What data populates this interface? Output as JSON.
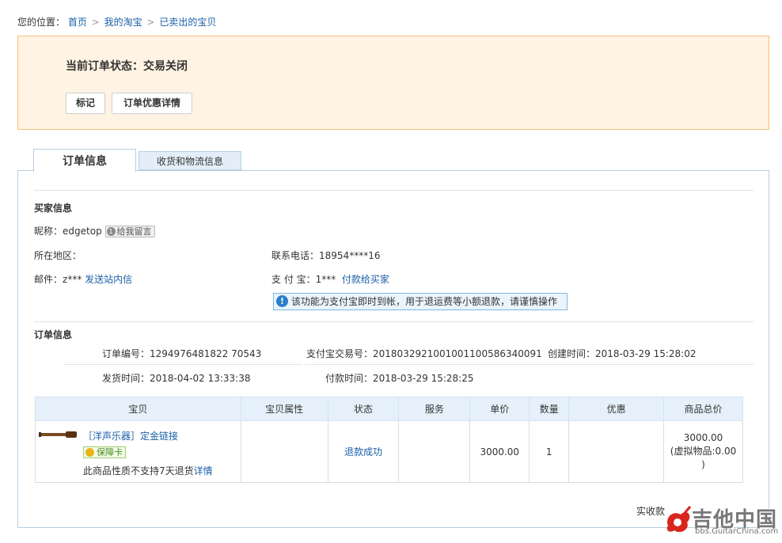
{
  "breadcrumb": {
    "prefix": "您的位置：",
    "items": [
      "首页",
      "我的淘宝",
      "已卖出的宝贝"
    ],
    "separator": ">"
  },
  "status": {
    "title": "当前订单状态：交易关闭",
    "buttons": {
      "mark": "标记",
      "discount_detail": "订单优惠详情"
    }
  },
  "tabs": [
    {
      "label": "订单信息",
      "active": true
    },
    {
      "label": "收货和物流信息",
      "active": false
    }
  ],
  "buyer": {
    "section_title": "买家信息",
    "nickname_label": "昵称：",
    "nickname": "edgetop",
    "message_button": "给我留言",
    "region_label": "所在地区：",
    "region": "",
    "phone_label": "联系电话：",
    "phone": "18954****16",
    "email_label": "邮件：",
    "email": "z***",
    "send_message_link": "发送站内信",
    "alipay_label": "支 付 宝：",
    "alipay": "1***",
    "pay_buyer_link": "付款给买家",
    "notice": "该功能为支付宝即时到帐，用于退运费等小额退款，请谨慎操作"
  },
  "order": {
    "section_title": "订单信息",
    "order_no_label": "订单编号：",
    "order_no": "1294976481822 70543",
    "alipay_trade_label": "支付宝交易号：",
    "alipay_trade_no": "2018032921001001100586340091",
    "created_label": "创建时间：",
    "created": "2018-03-29 15:28:02",
    "shipped_label": "发货时间：",
    "shipped": "2018-04-02 13:33:38",
    "paid_label": "付款时间：",
    "paid_time": "2018-03-29 15:28:25"
  },
  "table": {
    "headers": [
      "宝贝",
      "宝贝属性",
      "状态",
      "服务",
      "单价",
      "数量",
      "优惠",
      "商品总价"
    ],
    "row": {
      "name": "［洋声乐器］定金链接",
      "badge": "保障卡",
      "note_prefix": "此商品性质不支持7天退货",
      "note_link": "详情",
      "attributes": "",
      "status": "退款成功",
      "service": "",
      "unit_price": "3000.00",
      "quantity": "1",
      "discount": "",
      "total": "3000.00",
      "total_note": "(虚拟物品:0.00",
      "total_note_end": ")"
    }
  },
  "summary": {
    "paid_label": "实收款"
  },
  "watermark": {
    "text": "吉他中国",
    "url_text": "bbs.GuitarChina.com"
  },
  "colors": {
    "status_bg": "#fff3e3",
    "status_border": "#f5c37a",
    "link": "#1a5fa8",
    "header_bg": "#e6f0fa"
  }
}
